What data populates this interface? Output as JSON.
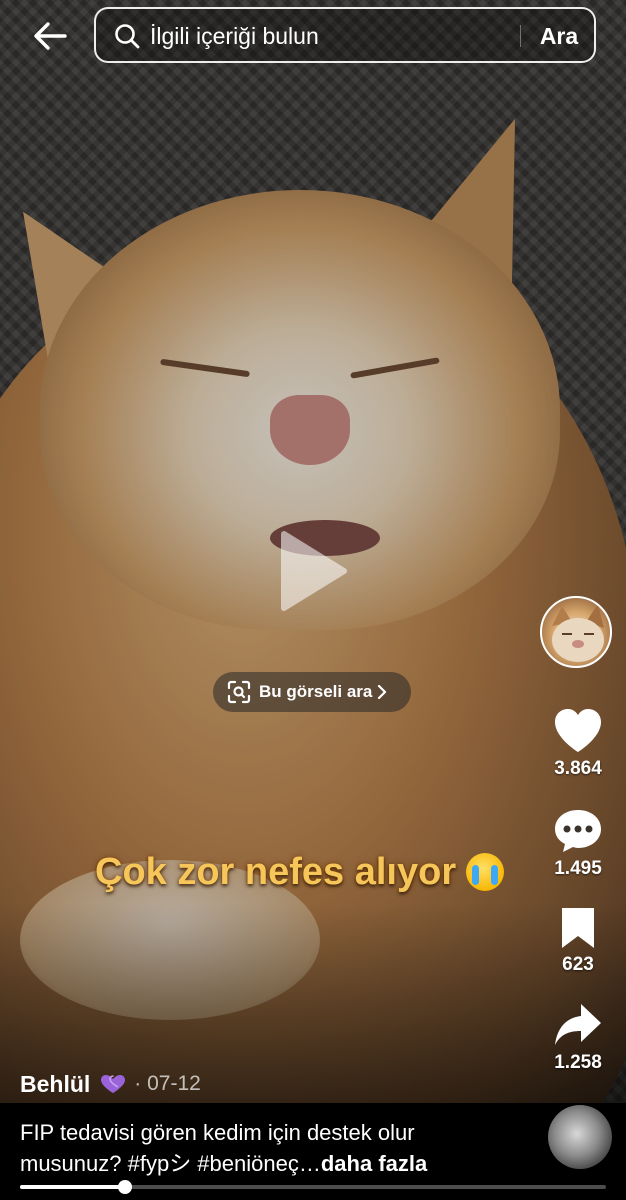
{
  "header": {
    "back_icon": "arrow-left-icon",
    "search": {
      "placeholder": "İlgili içeriği bulun",
      "button_label": "Ara"
    }
  },
  "video": {
    "play_icon": "play-icon",
    "image_search_label": "Bu görseli ara",
    "overlay_caption": "Çok zor nefes alıyor",
    "overlay_emoji": "crying-face-emoji",
    "progress": 0.18
  },
  "actions": {
    "likes": "3.864",
    "comments": "1.495",
    "saves": "623",
    "shares": "1.258"
  },
  "post": {
    "author": "Behlül",
    "date": "07-12",
    "description": "FIP tedavisi gören kedim için destek olur musunuz? #fypシ #beniöneç…",
    "more_label": "daha fazla"
  },
  "colors": {
    "caption": "#f6c65a",
    "background": "#000000",
    "text": "#ffffff"
  }
}
